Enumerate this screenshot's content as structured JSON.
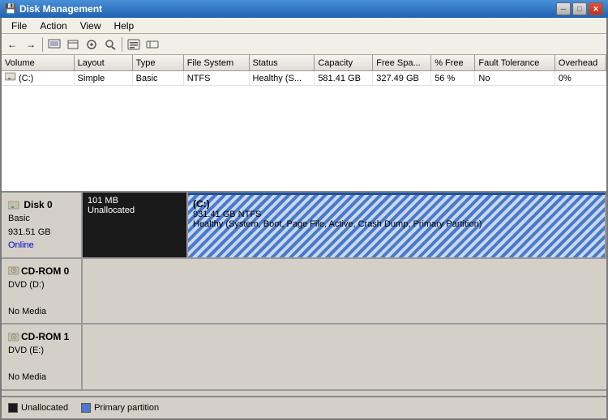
{
  "titlebar": {
    "title": "Disk Management",
    "icon": "💾",
    "minimize": "─",
    "restore": "□",
    "close": "✕"
  },
  "menubar": {
    "items": [
      {
        "id": "file",
        "label": "File"
      },
      {
        "id": "action",
        "label": "Action"
      },
      {
        "id": "view",
        "label": "View"
      },
      {
        "id": "help",
        "label": "Help"
      }
    ]
  },
  "toolbar": {
    "buttons": [
      "←",
      "→",
      "⬜",
      "🖫",
      "🖫",
      "⟳",
      "🔍",
      "⬜",
      "⬜"
    ]
  },
  "table": {
    "headers": [
      "Volume",
      "Layout",
      "Type",
      "File System",
      "Status",
      "Capacity",
      "Free Spa...",
      "% Free",
      "Fault Tolerance",
      "Overhead"
    ],
    "rows": [
      {
        "volume": "(C:)",
        "layout": "Simple",
        "type": "Basic",
        "filesystem": "NTFS",
        "status": "Healthy (S...",
        "capacity": "581.41 GB",
        "free": "327.49 GB",
        "pct": "56 %",
        "fault": "No",
        "overhead": "0%"
      }
    ]
  },
  "disks": [
    {
      "id": "disk0",
      "name": "Disk 0",
      "type": "Basic",
      "size": "931.51 GB",
      "status": "Online",
      "partitions": [
        {
          "id": "unalloc0",
          "label": "101 MB",
          "sublabel": "Unallocated",
          "type": "unallocated",
          "width_pct": 12
        },
        {
          "id": "c-drive",
          "label": "(C:)",
          "sublabel": "931.41 GB NTFS",
          "detail": "Healthy (System, Boot, Page File, Active, Crash Dump, Primary Partition)",
          "type": "primary",
          "width_pct": 88
        }
      ]
    },
    {
      "id": "cdrom0",
      "name": "CD-ROM 0",
      "type": "DVD (D:)",
      "status": "No Media",
      "partitions": []
    },
    {
      "id": "cdrom1",
      "name": "CD-ROM 1",
      "type": "DVD (E:)",
      "status": "No Media",
      "partitions": []
    }
  ],
  "legend": [
    {
      "id": "unallocated",
      "label": "Unallocated",
      "color": "unalloc"
    },
    {
      "id": "primary",
      "label": "Primary partition",
      "color": "primary"
    }
  ]
}
